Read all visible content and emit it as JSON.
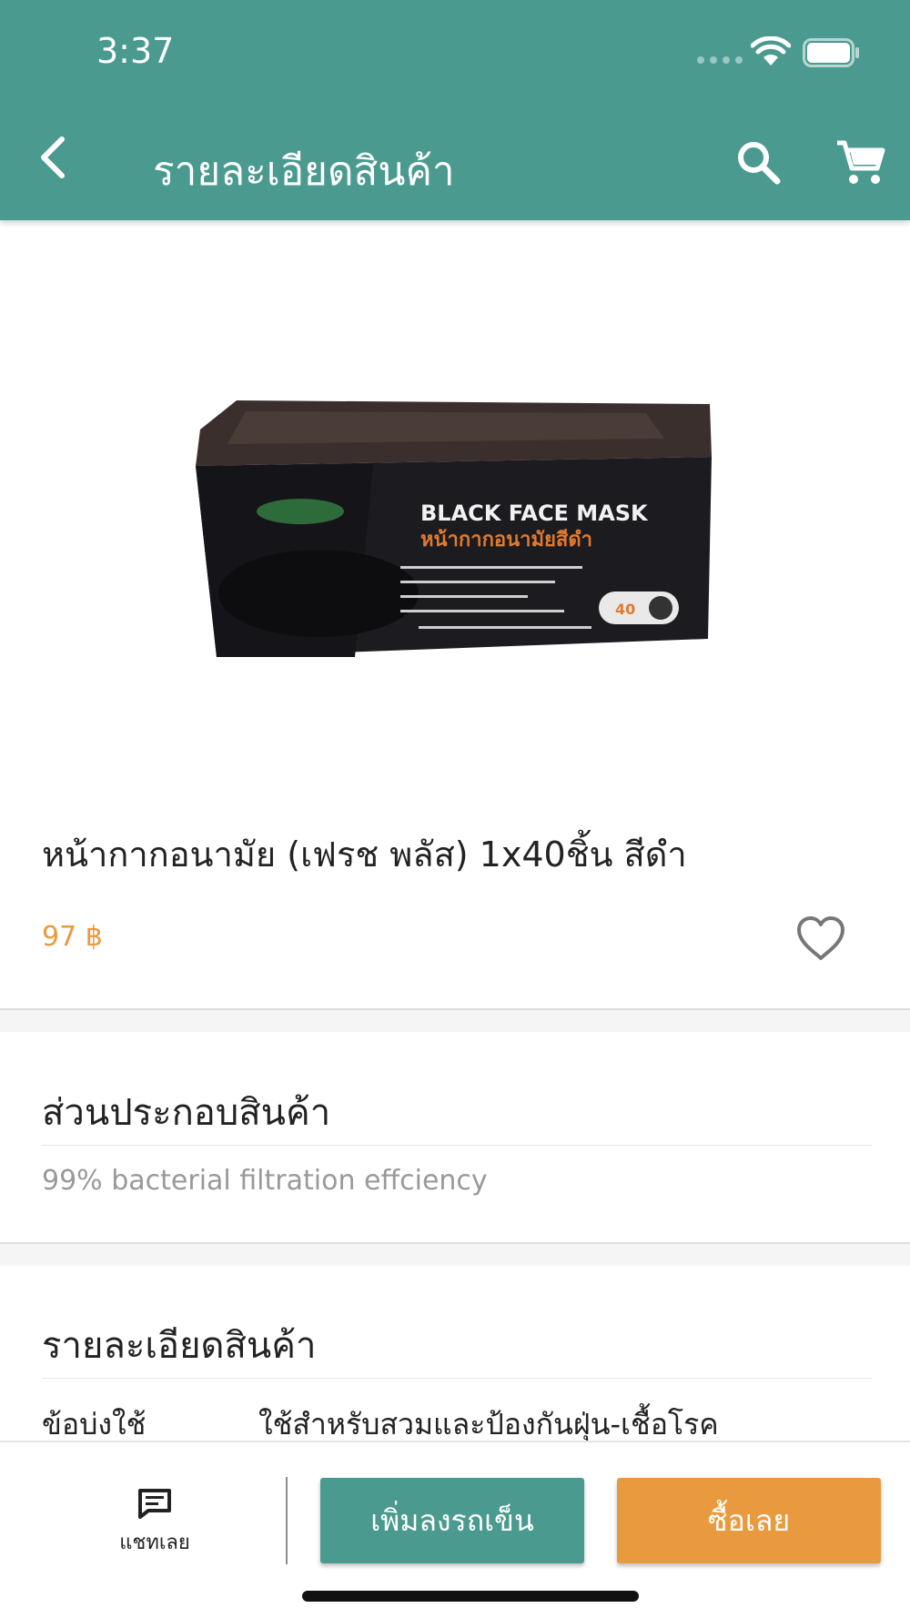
{
  "status_bar": {
    "time": "3:37"
  },
  "header": {
    "title": "รายละเอียดสินค้า"
  },
  "product": {
    "box_brand": "BLACK FACE MASK",
    "box_thai": "หน้ากากอนามัยสีดำ",
    "box_count": "40",
    "name": "หน้ากากอนามัย (เฟรช พลัส) 1x40ชิ้น สีดำ",
    "price": "97 ฿"
  },
  "ingredients": {
    "title": "ส่วนประกอบสินค้า",
    "text": "99% bacterial filtration effciency"
  },
  "details": {
    "title": "รายละเอียดสินค้า",
    "label": "ข้อบ่งใช้",
    "value": "ใช้สำหรับสวมและป้องกันฝุ่น-เชื้อโรค"
  },
  "bottom_bar": {
    "chat_label": "แชทเลย",
    "add_to_cart_label": "เพิ่มลงรถเข็น",
    "buy_now_label": "ซื้อเลย"
  },
  "colors": {
    "primary": "#4a9a8f",
    "accent": "#e99a3e"
  },
  "icons": [
    "back-arrow-icon",
    "search-icon",
    "cart-icon",
    "heart-icon",
    "chat-icon",
    "wifi-icon",
    "battery-icon"
  ]
}
